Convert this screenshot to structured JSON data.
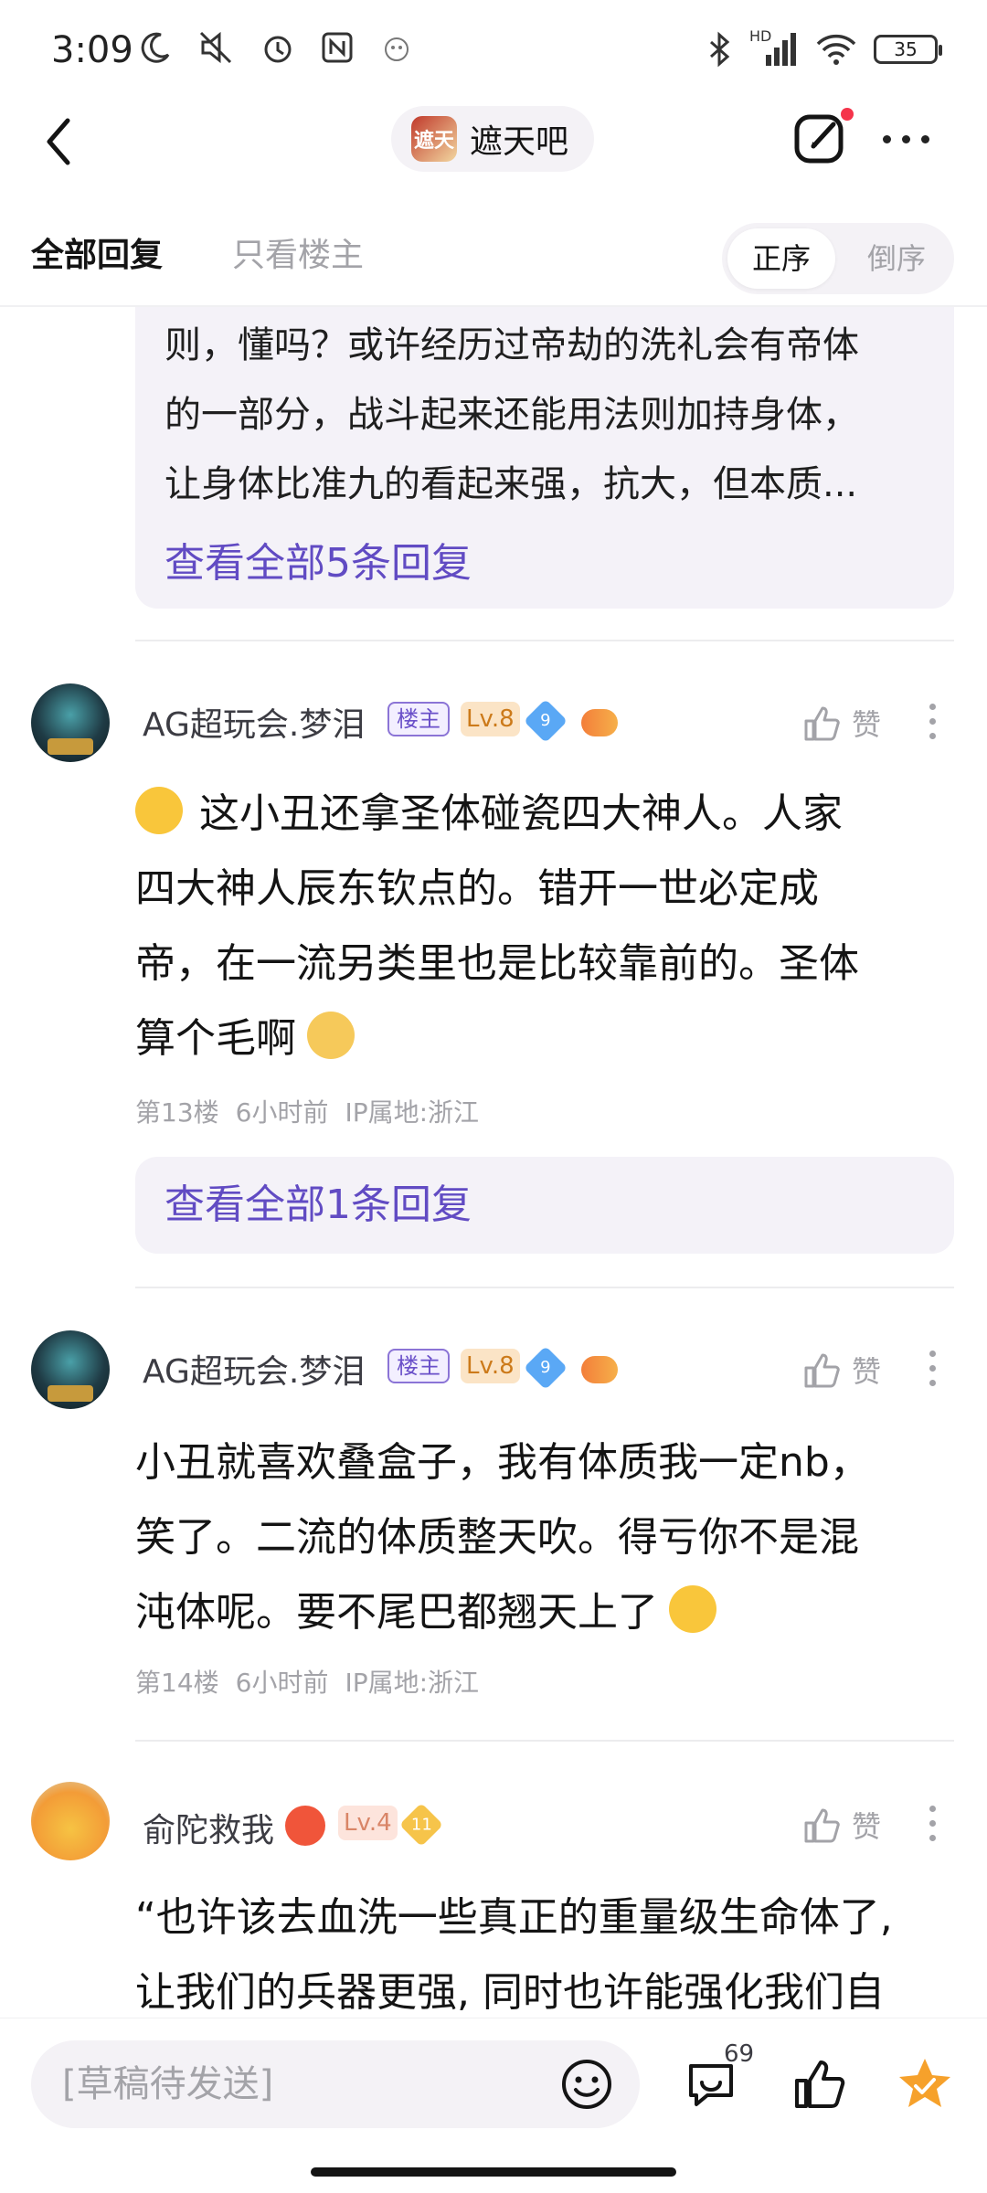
{
  "status_bar": {
    "time": "3:09",
    "network_label": "HD",
    "battery": "35"
  },
  "header": {
    "forum_logo_text": "遮天",
    "forum_name": "遮天吧"
  },
  "tabs": {
    "all_replies": "全部回复",
    "op_only": "只看楼主",
    "sort_asc": "正序",
    "sort_desc": "倒序"
  },
  "top_reply_box": {
    "lines": [
      "则，懂吗？或许经历过帝劫的洗礼会有帝体",
      "的一部分，战斗起来还能用法则加持身体，",
      "让身体比准九的看起来强，抗大，但本质..."
    ],
    "view_all": "查看全部5条回复"
  },
  "comments": [
    {
      "username": "AG超玩会.梦泪",
      "op_badge": "楼主",
      "level": "Lv.8",
      "gem_level": "9",
      "like_label": "赞",
      "lines": [
        "这小丑还拿圣体碰瓷四大神人。人家",
        "四大神人辰东钦点的。错开一世必定成",
        "帝，在一流另类里也是比较靠前的。圣体",
        "算个毛啊"
      ],
      "floor": "第13楼",
      "time": "6小时前",
      "ip": "IP属地:浙江",
      "view_all": "查看全部1条回复"
    },
    {
      "username": "AG超玩会.梦泪",
      "op_badge": "楼主",
      "level": "Lv.8",
      "gem_level": "9",
      "like_label": "赞",
      "lines": [
        "小丑就喜欢叠盒子，我有体质我一定nb，",
        "笑了。二流的体质整天吹。得亏你不是混",
        "沌体呢。要不尾巴都翘天上了"
      ],
      "floor": "第14楼",
      "time": "6小时前",
      "ip": "IP属地:浙江"
    },
    {
      "username": "俞陀救我",
      "level": "Lv.4",
      "gem_level": "11",
      "like_label": "赞",
      "lines": [
        "“也许该去血洗一些真正的重量级生命体了,",
        "让我们的兵器更强, 同时也许能强化我们自"
      ]
    }
  ],
  "bottom_bar": {
    "draft_placeholder": "[草稿待发送]",
    "reply_count": "69"
  },
  "colors": {
    "accent": "#614bc3",
    "reply_bg": "#f4f2f8",
    "muted": "#a3a3a8",
    "star": "#f6a12b"
  }
}
